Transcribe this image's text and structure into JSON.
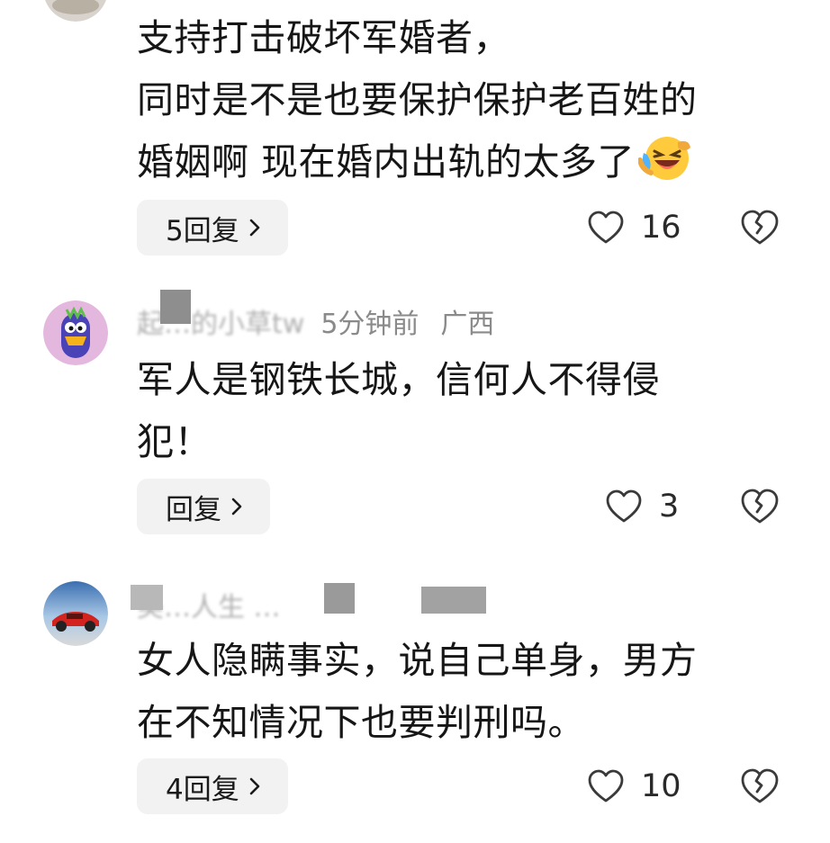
{
  "comments": [
    {
      "lines": [
        "支持打击破坏军婚者，",
        "同时是不是也要保护保护老百姓的",
        "婚姻啊 现在婚内出轨的太多了"
      ],
      "emoji": "laughing-crying-emoji",
      "reply_label": "5回复",
      "likes": "16"
    },
    {
      "username": "起…的小草tw",
      "time": "5分钟前",
      "location": "广西",
      "lines": [
        "军人是钢铁长城，信何人不得侵",
        "犯！"
      ],
      "reply_label": "回复",
      "likes": "3"
    },
    {
      "username": "美…人生 …",
      "lines": [
        "女人隐瞒事实，说自己单身，男方",
        "在不知情况下也要判刑吗。"
      ],
      "reply_label": "4回复",
      "likes": "10"
    }
  ],
  "icons": {
    "like": "heart-outline-icon",
    "dislike": "broken-heart-icon",
    "reply_arrow": "chevron-right-icon"
  },
  "colors": {
    "text": "#161616",
    "meta": "#8a8a8a",
    "reply_bg": "#f2f2f2",
    "icon": "#3a3a3a"
  }
}
